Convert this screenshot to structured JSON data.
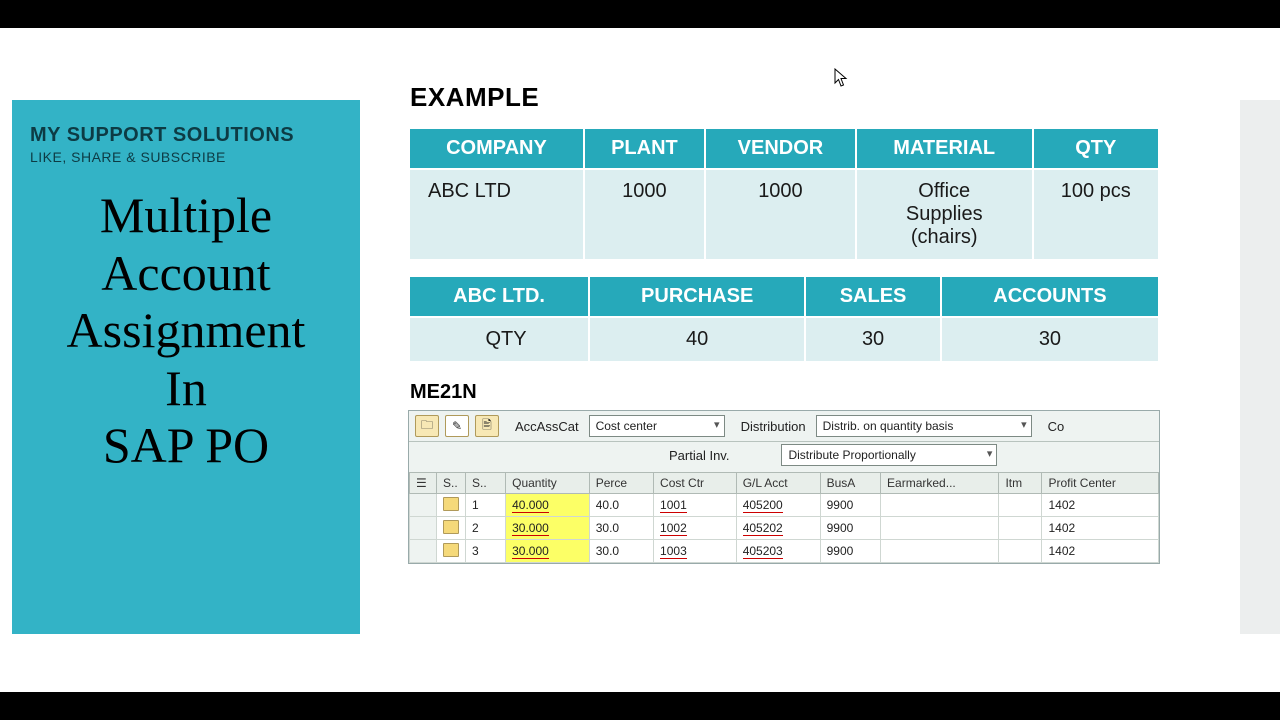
{
  "side": {
    "brand": "MY SUPPORT SOLUTIONS",
    "tag": "LIKE, SHARE &  SUBSCRIBE",
    "headline_l1": "Multiple",
    "headline_l2": "Account",
    "headline_l3": "Assignment",
    "headline_l4": "In",
    "headline_l5": "SAP PO"
  },
  "example_label": "EXAMPLE",
  "example_table": {
    "headers": [
      "COMPANY",
      "PLANT",
      "VENDOR",
      "MATERIAL",
      "QTY"
    ],
    "row": {
      "company": "ABC LTD",
      "plant": "1000",
      "vendor": "1000",
      "material_l1": "Office",
      "material_l2": "Supplies",
      "material_l3": "(chairs)",
      "qty": "100 pcs"
    }
  },
  "dist_table": {
    "headers": [
      "ABC LTD.",
      "PURCHASE",
      "SALES",
      "ACCOUNTS"
    ],
    "row_label": "QTY",
    "values": [
      "40",
      "30",
      "30"
    ]
  },
  "tcode": "ME21N",
  "sap": {
    "acc_ass_cat_label": "AccAssCat",
    "acc_ass_cat_value": "Cost center",
    "distribution_label": "Distribution",
    "distribution_value": "Distrib. on quantity basis",
    "partial_inv_label": "Partial Inv.",
    "partial_inv_value": "Distribute Proportionally",
    "co_label": "Co",
    "columns": [
      "S..",
      "S..",
      "Quantity",
      "Perce",
      "Cost Ctr",
      "G/L Acct",
      "BusA",
      "Earmarked...",
      "Itm",
      "Profit Center"
    ],
    "rows": [
      {
        "seq": "1",
        "qty": "40.000",
        "perc": "40.0",
        "cc": "1001",
        "gl": "405200",
        "busa": "9900",
        "ear": "",
        "itm": "",
        "pc": "1402"
      },
      {
        "seq": "2",
        "qty": "30.000",
        "perc": "30.0",
        "cc": "1002",
        "gl": "405202",
        "busa": "9900",
        "ear": "",
        "itm": "",
        "pc": "1402"
      },
      {
        "seq": "3",
        "qty": "30.000",
        "perc": "30.0",
        "cc": "1003",
        "gl": "405203",
        "busa": "9900",
        "ear": "",
        "itm": "",
        "pc": "1402"
      }
    ]
  }
}
